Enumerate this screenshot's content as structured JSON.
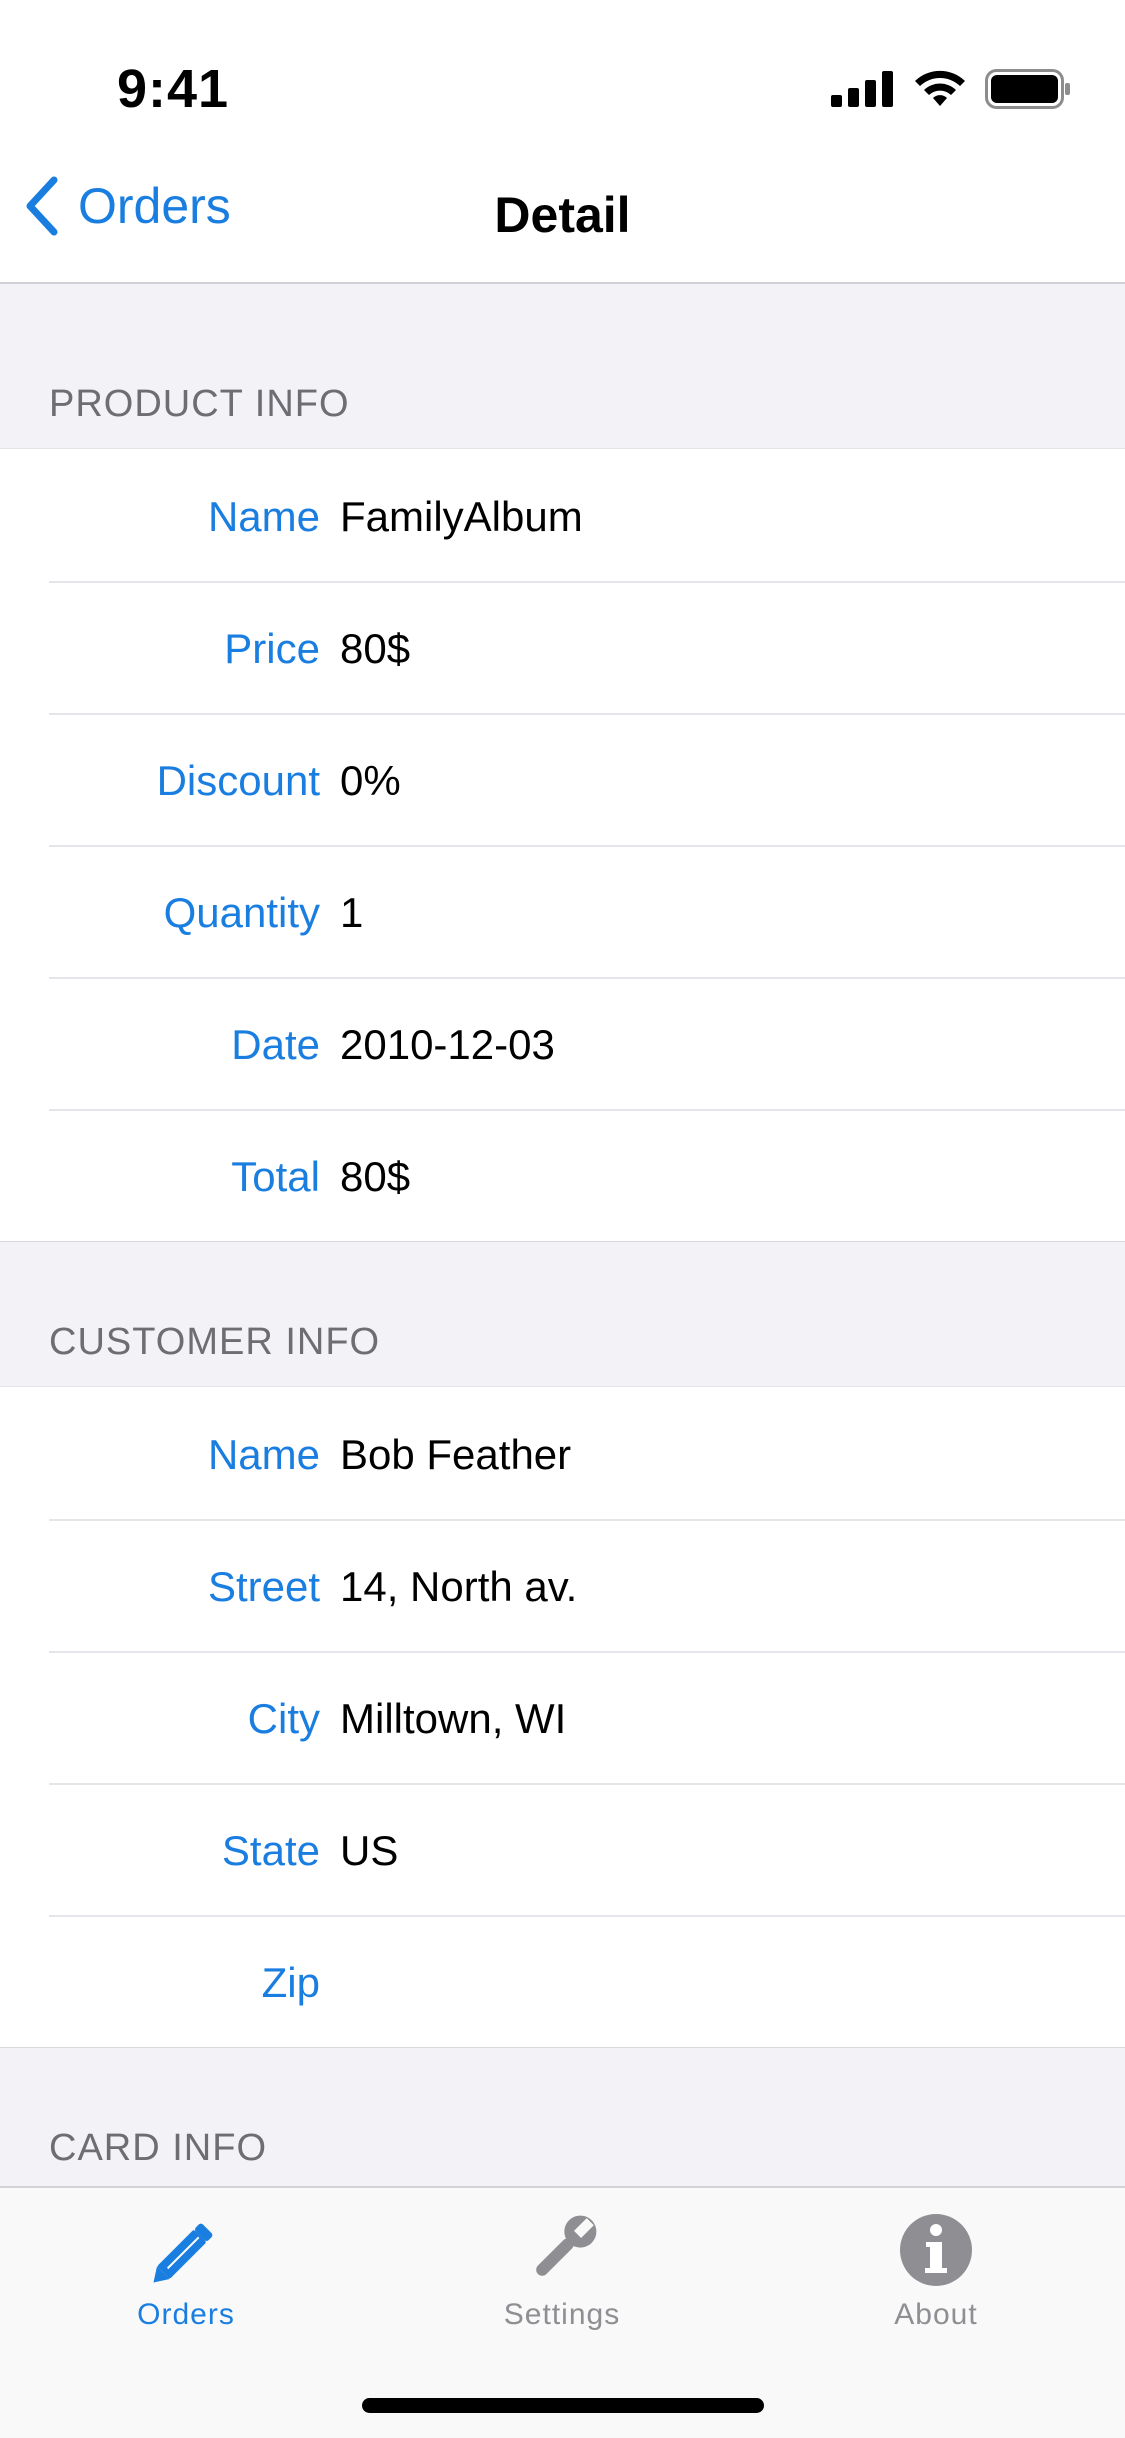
{
  "status_bar": {
    "time": "9:41"
  },
  "nav": {
    "back_label": "Orders",
    "title": "Detail"
  },
  "sections": [
    {
      "header": "PRODUCT INFO",
      "rows": [
        {
          "label": "Name",
          "value": "FamilyAlbum"
        },
        {
          "label": "Price",
          "value": "80$"
        },
        {
          "label": "Discount",
          "value": "0%"
        },
        {
          "label": "Quantity",
          "value": "1"
        },
        {
          "label": "Date",
          "value": "2010-12-03"
        },
        {
          "label": "Total",
          "value": "80$"
        }
      ]
    },
    {
      "header": "CUSTOMER INFO",
      "rows": [
        {
          "label": "Name",
          "value": "Bob Feather"
        },
        {
          "label": "Street",
          "value": "14, North av."
        },
        {
          "label": "City",
          "value": "Milltown, WI"
        },
        {
          "label": "State",
          "value": "US"
        },
        {
          "label": "Zip",
          "value": ""
        }
      ]
    },
    {
      "header": "CARD INFO",
      "rows": []
    }
  ],
  "tabs": [
    {
      "label": "Orders",
      "icon": "pencil-icon",
      "active": true
    },
    {
      "label": "Settings",
      "icon": "wrench-icon",
      "active": false
    },
    {
      "label": "About",
      "icon": "info-icon",
      "active": false
    }
  ],
  "colors": {
    "accent": "#1a7ee0",
    "inactive": "#8e8e93",
    "background": "#f2f2f7"
  }
}
